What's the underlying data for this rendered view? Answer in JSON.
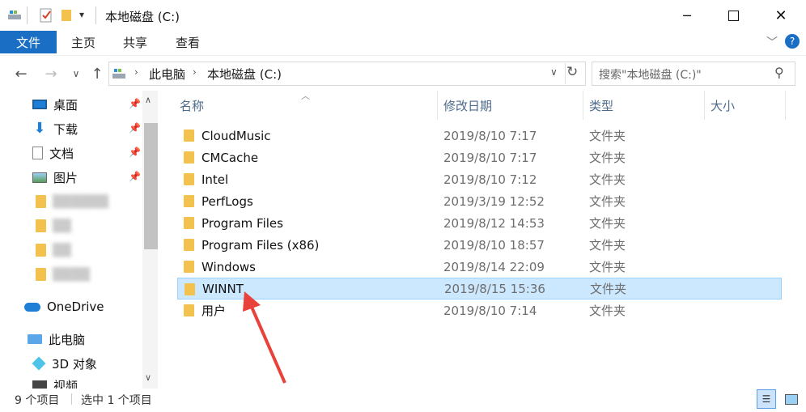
{
  "window": {
    "title": "本地磁盘 (C:)",
    "controls": [
      "minimize",
      "maximize",
      "close"
    ]
  },
  "ribbon": {
    "file_tab": "文件",
    "tabs": [
      "主页",
      "共享",
      "查看"
    ]
  },
  "address": {
    "crumbs": [
      "此电脑",
      "本地磁盘 (C:)"
    ],
    "search_placeholder": "搜索\"本地磁盘 (C:)\""
  },
  "sidebar": {
    "quick_access": [
      {
        "label": "桌面",
        "icon": "desktop-icon",
        "pinned": true
      },
      {
        "label": "下载",
        "icon": "download-icon",
        "pinned": true
      },
      {
        "label": "文档",
        "icon": "document-icon",
        "pinned": true
      },
      {
        "label": "图片",
        "icon": "picture-icon",
        "pinned": true
      },
      {
        "label": "▒▒▒▒▒▒",
        "icon": "folder-icon",
        "blurred": true
      },
      {
        "label": "▒▒",
        "icon": "folder-icon",
        "blurred": true
      },
      {
        "label": "▒▒",
        "icon": "folder-icon",
        "blurred": true
      },
      {
        "label": "▒▒▒▒",
        "icon": "folder-icon",
        "blurred": true
      }
    ],
    "onedrive": "OneDrive",
    "this_pc": "此电脑",
    "objects3d": "3D 对象",
    "videos": "视频"
  },
  "columns": {
    "name": "名称",
    "date": "修改日期",
    "type": "类型",
    "size": "大小"
  },
  "files": [
    {
      "name": "CloudMusic",
      "date": "2019/8/10 7:17",
      "type": "文件夹"
    },
    {
      "name": "CMCache",
      "date": "2019/8/10 7:17",
      "type": "文件夹"
    },
    {
      "name": "Intel",
      "date": "2019/8/10 7:12",
      "type": "文件夹"
    },
    {
      "name": "PerfLogs",
      "date": "2019/3/19 12:52",
      "type": "文件夹"
    },
    {
      "name": "Program Files",
      "date": "2019/8/12 14:53",
      "type": "文件夹"
    },
    {
      "name": "Program Files (x86)",
      "date": "2019/8/10 18:57",
      "type": "文件夹"
    },
    {
      "name": "Windows",
      "date": "2019/8/14 22:09",
      "type": "文件夹"
    },
    {
      "name": "WINNT",
      "date": "2019/8/15 15:36",
      "type": "文件夹",
      "selected": true
    },
    {
      "name": "用户",
      "date": "2019/8/10 7:14",
      "type": "文件夹"
    }
  ],
  "status": {
    "count": "9 个项目",
    "selected": "选中 1 个项目"
  },
  "colors": {
    "accent": "#1a6fc4",
    "selection": "#cce8ff",
    "folder": "#f2c14e",
    "annotation_arrow": "#e8423a"
  }
}
